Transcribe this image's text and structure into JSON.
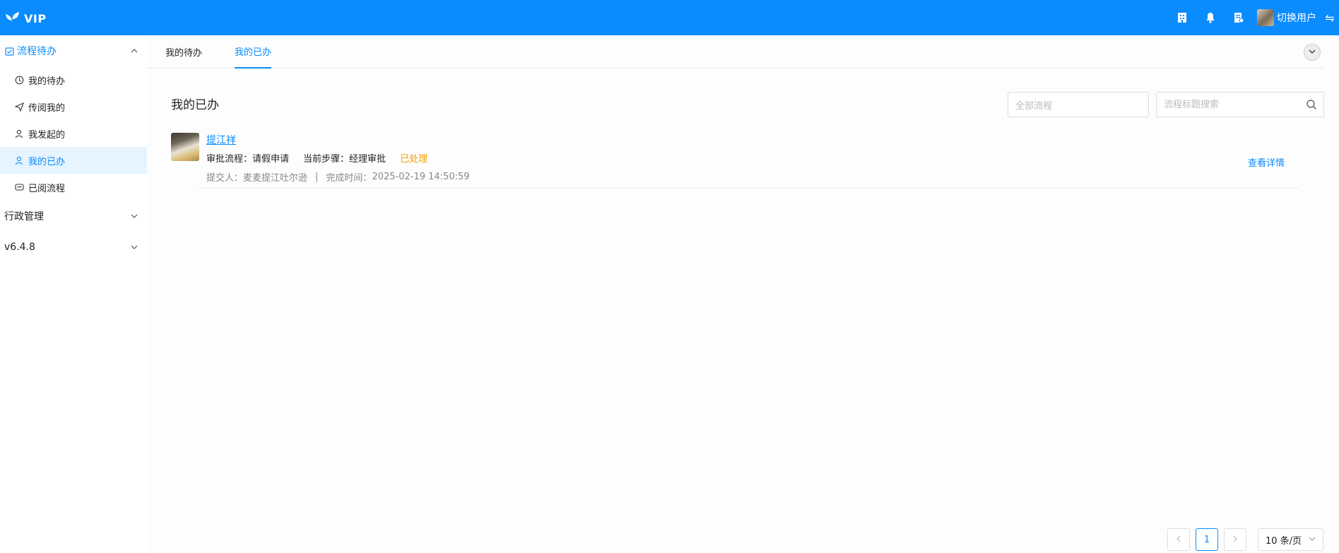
{
  "app": {
    "logo_text": "VIP"
  },
  "topbar": {
    "user_name": "切换用户"
  },
  "sidebar": {
    "groups": [
      {
        "label": "流程待办",
        "items": [
          {
            "label": "我的待办"
          },
          {
            "label": "传阅我的"
          },
          {
            "label": "我发起的"
          },
          {
            "label": "我的已办"
          },
          {
            "label": "已阅流程"
          }
        ]
      },
      {
        "label": "行政管理"
      },
      {
        "label": "v6.4.8"
      }
    ],
    "active_item": "我的已办"
  },
  "tabs": [
    {
      "label": "我的待办"
    },
    {
      "label": "我的已办"
    }
  ],
  "page": {
    "title": "我的已办",
    "filter_placeholder": "全部流程",
    "search_placeholder": "流程标题搜索"
  },
  "tasks": [
    {
      "title": "提江祥",
      "process_label": "审批流程：",
      "process_value": "请假申请",
      "step_label": "当前步骤：",
      "step_value": "经理审批",
      "status": "已处理",
      "submitter_label": "提交人：",
      "submitter": "麦麦提江吐尔逊",
      "separator": "|",
      "finish_label": "完成时间：",
      "finish_time": "2025-02-19 14:50:59",
      "action": "查看详情"
    }
  ],
  "pagination": {
    "current": "1",
    "page_size": "10 条/页"
  },
  "colors": {
    "primary": "#0a8cff",
    "status_done": "#f5a000",
    "active_bg": "#e6f4ff"
  }
}
